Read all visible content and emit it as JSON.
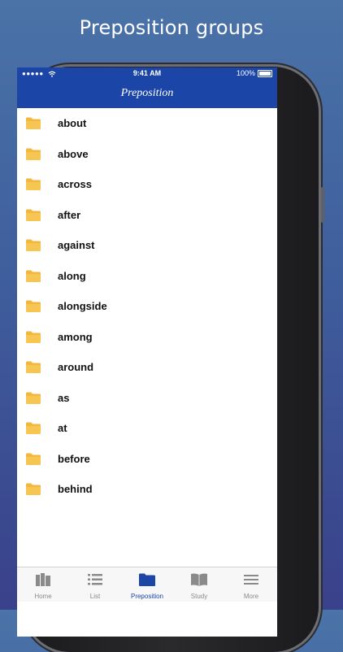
{
  "promo": {
    "title": "Preposition groups"
  },
  "status_bar": {
    "signal": "●●●●●",
    "time": "9:41 AM",
    "battery": "100%"
  },
  "nav": {
    "title": "Preposition"
  },
  "list": {
    "items": [
      "about",
      "above",
      "across",
      "after",
      "against",
      "along",
      "alongside",
      "among",
      "around",
      "as",
      "at",
      "before",
      "behind"
    ]
  },
  "tabs": [
    {
      "label": "Home",
      "icon": "books-icon",
      "active": false
    },
    {
      "label": "List",
      "icon": "list-icon",
      "active": false
    },
    {
      "label": "Preposition",
      "icon": "folder-icon",
      "active": true
    },
    {
      "label": "Study",
      "icon": "open-book-icon",
      "active": false
    },
    {
      "label": "More",
      "icon": "menu-icon",
      "active": false
    }
  ],
  "colors": {
    "accent": "#1b45a6",
    "folder": "#f3b73d",
    "background": "#4a6aa5"
  }
}
